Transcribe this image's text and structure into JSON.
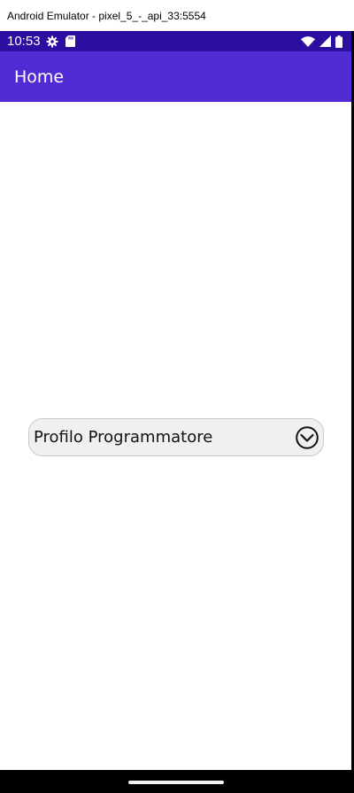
{
  "window": {
    "title": "Android Emulator - pixel_5_-_api_33:5554"
  },
  "status_bar": {
    "time": "10:53",
    "left_icons": [
      "settings-icon",
      "sd-card-icon"
    ],
    "right_icons": [
      "wifi-icon",
      "signal-icon",
      "battery-icon"
    ],
    "background": "#2b0fa0"
  },
  "app_bar": {
    "title": "Home",
    "background": "#512bd4"
  },
  "picker": {
    "selected": "Profilo Programmatore",
    "icon": "chevron-down-circle-icon"
  },
  "nav_bar": {
    "icon": "home-handle"
  }
}
